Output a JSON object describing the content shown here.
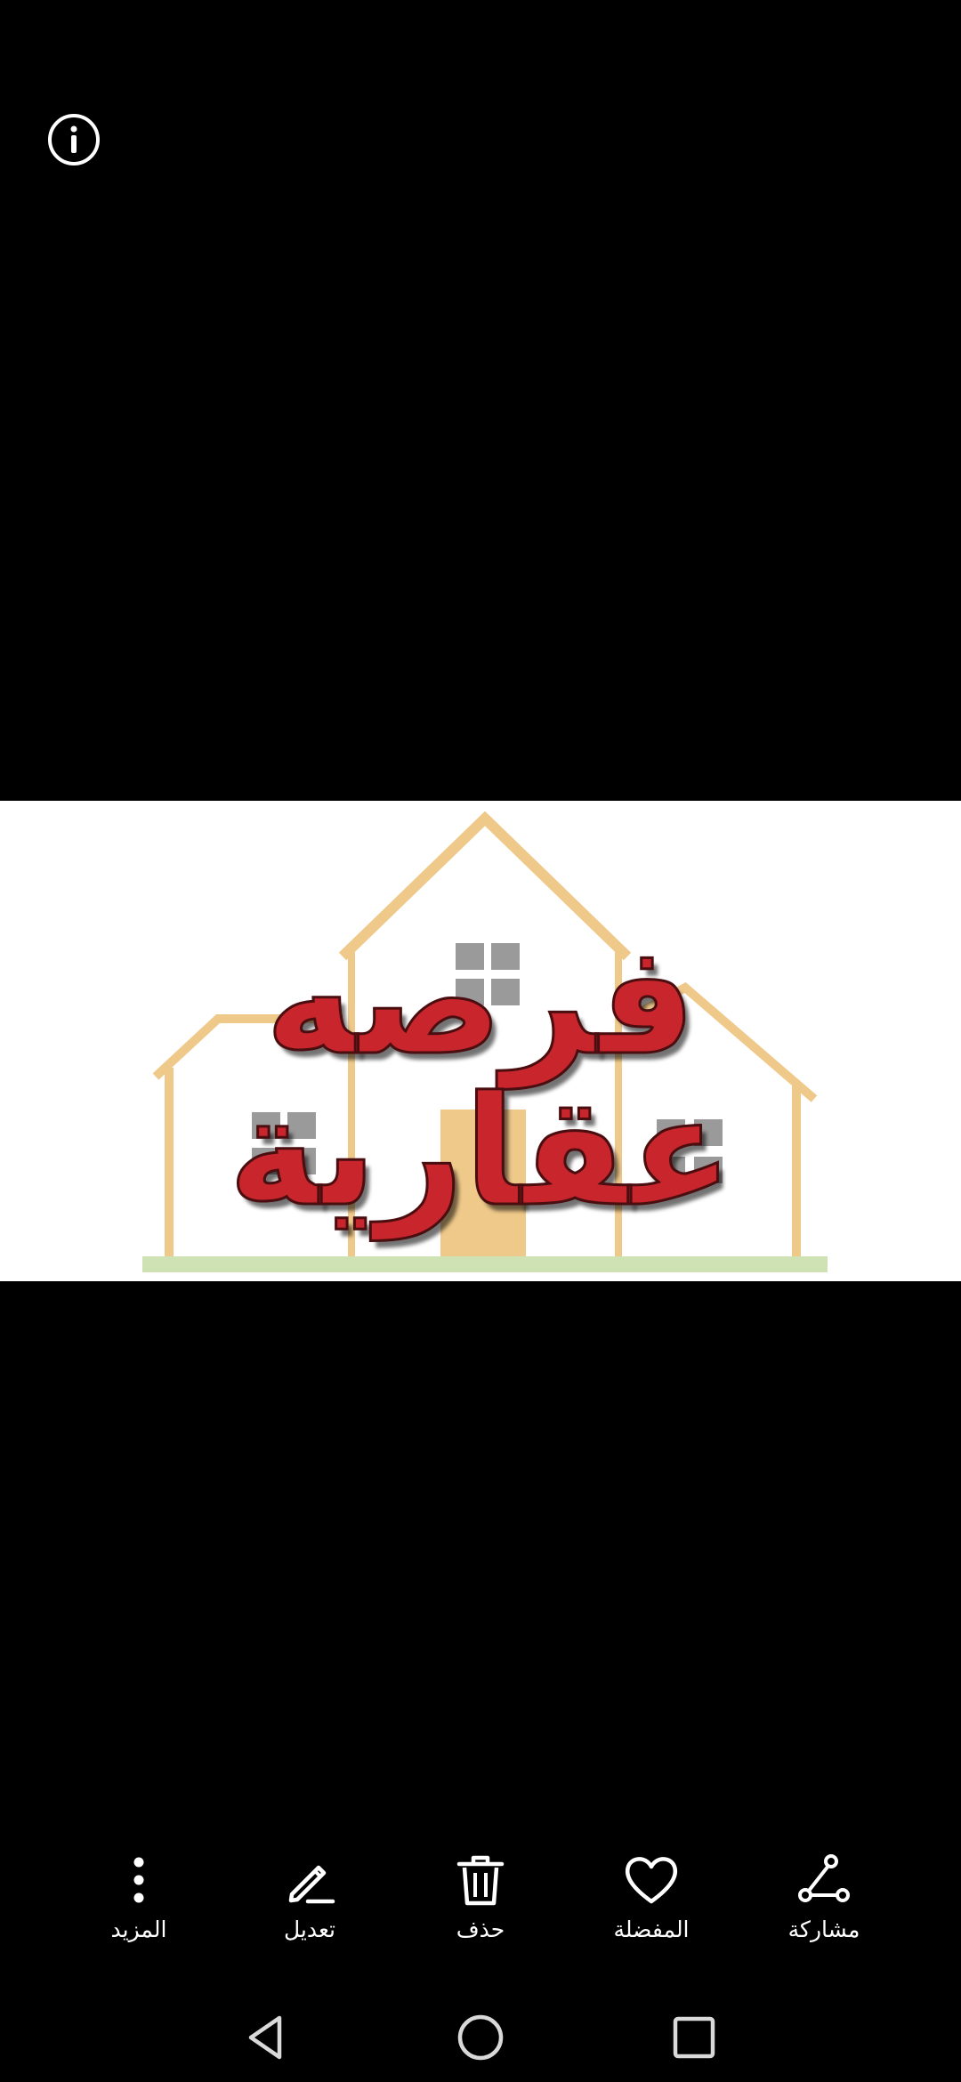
{
  "top_bar": {
    "info_icon": "info-circle-icon"
  },
  "photo": {
    "caption": "فرصه عقارية",
    "colors": {
      "house_outline": "#efc98a",
      "door": "#efc98a",
      "windows": "#9a9a9a",
      "ground": "#cfe2b4",
      "text_fill": "#c8262c"
    }
  },
  "toolbar": {
    "items": [
      {
        "label": "المزيد",
        "icon": "more-vertical-icon"
      },
      {
        "label": "تعديل",
        "icon": "edit-pencil-icon"
      },
      {
        "label": "حذف",
        "icon": "trash-icon"
      },
      {
        "label": "المفضلة",
        "icon": "heart-icon"
      },
      {
        "label": "مشاركة",
        "icon": "share-icon"
      }
    ]
  },
  "navbar": {
    "items": [
      {
        "icon": "back-triangle-icon"
      },
      {
        "icon": "home-circle-icon"
      },
      {
        "icon": "recents-square-icon"
      }
    ]
  }
}
